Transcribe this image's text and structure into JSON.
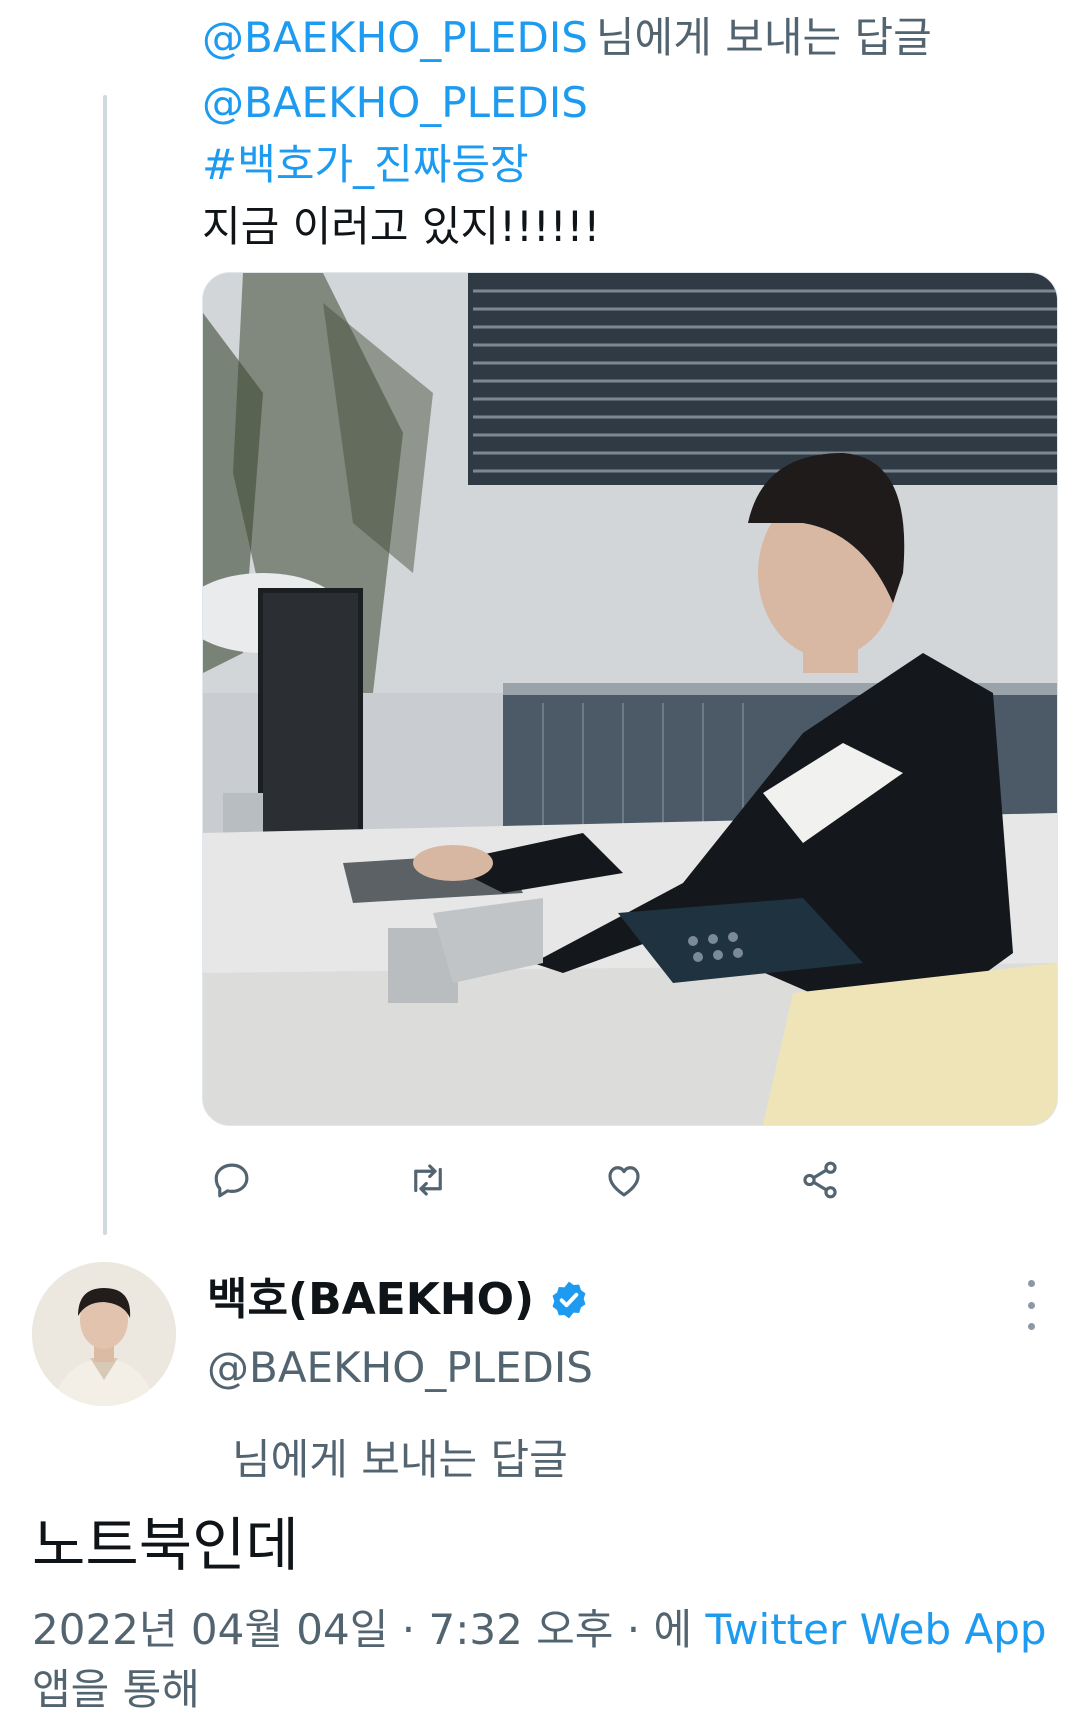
{
  "parent_tweet": {
    "reply_mention": "@BAEKHO_PLEDIS",
    "reply_suffix": "님에게 보내는 답글",
    "lines": {
      "mention": "@BAEKHO_PLEDIS",
      "hashtag": "#백호가_진짜등장",
      "text": "지금 이러고 있지!!!!!!"
    },
    "actions": [
      "reply-icon",
      "retweet-icon",
      "like-icon",
      "share-icon"
    ]
  },
  "main_tweet": {
    "display_name": "백호(BAEKHO)",
    "handle": "@BAEKHO_PLEDIS",
    "reply_label": "님에게 보내는 답글",
    "text": "노트북인데",
    "meta": {
      "date": "2022년 04월 04일",
      "sep1": " · ",
      "time": "7:32 오후",
      "sep2": " · ",
      "via_prefix": "에 ",
      "app": "Twitter Web App",
      "via_suffix": "앱을 통해"
    }
  },
  "colors": {
    "link": "#1d9bf0",
    "secondary": "#536471",
    "verified": "#1d9bf0"
  }
}
